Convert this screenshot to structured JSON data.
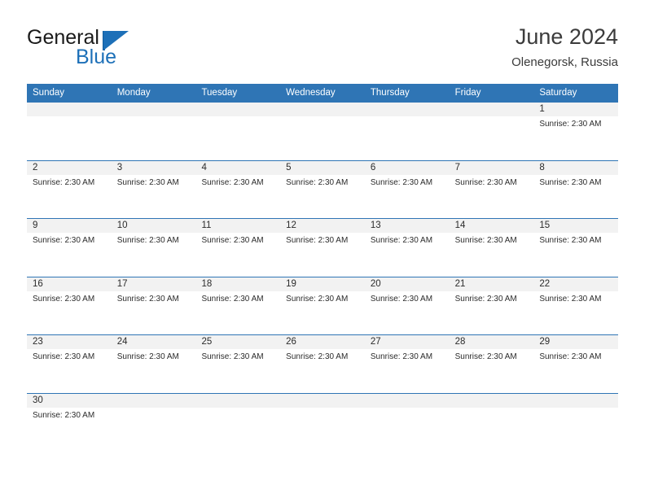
{
  "brand": {
    "name_part1": "General",
    "name_part2": "Blue",
    "triangle_color": "#1d70b8"
  },
  "header": {
    "title": "June 2024",
    "subtitle": "Olenegorsk, Russia"
  },
  "colors": {
    "header_blue": "#2f75b5",
    "daynum_band": "#f2f2f2",
    "row_separator": "#2f75b5",
    "text": "#2b2b2b"
  },
  "weekdays": [
    "Sunday",
    "Monday",
    "Tuesday",
    "Wednesday",
    "Thursday",
    "Friday",
    "Saturday"
  ],
  "weeks": [
    {
      "days": [
        {
          "num": "",
          "event": ""
        },
        {
          "num": "",
          "event": ""
        },
        {
          "num": "",
          "event": ""
        },
        {
          "num": "",
          "event": ""
        },
        {
          "num": "",
          "event": ""
        },
        {
          "num": "",
          "event": ""
        },
        {
          "num": "1",
          "event": "Sunrise: 2:30 AM"
        }
      ]
    },
    {
      "days": [
        {
          "num": "2",
          "event": "Sunrise: 2:30 AM"
        },
        {
          "num": "3",
          "event": "Sunrise: 2:30 AM"
        },
        {
          "num": "4",
          "event": "Sunrise: 2:30 AM"
        },
        {
          "num": "5",
          "event": "Sunrise: 2:30 AM"
        },
        {
          "num": "6",
          "event": "Sunrise: 2:30 AM"
        },
        {
          "num": "7",
          "event": "Sunrise: 2:30 AM"
        },
        {
          "num": "8",
          "event": "Sunrise: 2:30 AM"
        }
      ]
    },
    {
      "days": [
        {
          "num": "9",
          "event": "Sunrise: 2:30 AM"
        },
        {
          "num": "10",
          "event": "Sunrise: 2:30 AM"
        },
        {
          "num": "11",
          "event": "Sunrise: 2:30 AM"
        },
        {
          "num": "12",
          "event": "Sunrise: 2:30 AM"
        },
        {
          "num": "13",
          "event": "Sunrise: 2:30 AM"
        },
        {
          "num": "14",
          "event": "Sunrise: 2:30 AM"
        },
        {
          "num": "15",
          "event": "Sunrise: 2:30 AM"
        }
      ]
    },
    {
      "days": [
        {
          "num": "16",
          "event": "Sunrise: 2:30 AM"
        },
        {
          "num": "17",
          "event": "Sunrise: 2:30 AM"
        },
        {
          "num": "18",
          "event": "Sunrise: 2:30 AM"
        },
        {
          "num": "19",
          "event": "Sunrise: 2:30 AM"
        },
        {
          "num": "20",
          "event": "Sunrise: 2:30 AM"
        },
        {
          "num": "21",
          "event": "Sunrise: 2:30 AM"
        },
        {
          "num": "22",
          "event": "Sunrise: 2:30 AM"
        }
      ]
    },
    {
      "days": [
        {
          "num": "23",
          "event": "Sunrise: 2:30 AM"
        },
        {
          "num": "24",
          "event": "Sunrise: 2:30 AM"
        },
        {
          "num": "25",
          "event": "Sunrise: 2:30 AM"
        },
        {
          "num": "26",
          "event": "Sunrise: 2:30 AM"
        },
        {
          "num": "27",
          "event": "Sunrise: 2:30 AM"
        },
        {
          "num": "28",
          "event": "Sunrise: 2:30 AM"
        },
        {
          "num": "29",
          "event": "Sunrise: 2:30 AM"
        }
      ]
    },
    {
      "days": [
        {
          "num": "30",
          "event": "Sunrise: 2:30 AM"
        },
        {
          "num": "",
          "event": ""
        },
        {
          "num": "",
          "event": ""
        },
        {
          "num": "",
          "event": ""
        },
        {
          "num": "",
          "event": ""
        },
        {
          "num": "",
          "event": ""
        },
        {
          "num": "",
          "event": ""
        }
      ]
    }
  ]
}
